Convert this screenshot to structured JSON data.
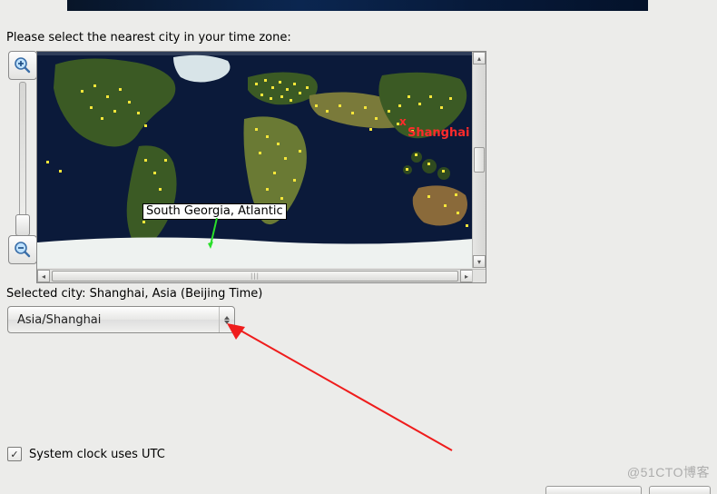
{
  "colors": {
    "ocean": "#0b1a3a",
    "land_dark": "#20361a",
    "land_mid": "#3b5a24",
    "land_light": "#6a8a3a",
    "desert": "#a08a4a",
    "snow": "#eef2f0",
    "city_dot": "#f5e63a",
    "selected_red": "#ff2b2b",
    "anno_red": "#ef1c1c"
  },
  "prompt": "Please select the nearest city in your time zone:",
  "map": {
    "selected_marker": "x",
    "selected_label": "Shanghai",
    "hover_label": "South Georgia, Atlantic"
  },
  "selected_city_line": "Selected city: Shanghai, Asia (Beijing Time)",
  "timezone_select": {
    "value": "Asia/Shanghai"
  },
  "utc_checkbox": {
    "checked": true,
    "label": "System clock uses UTC"
  },
  "watermark": "@51CTO博客"
}
